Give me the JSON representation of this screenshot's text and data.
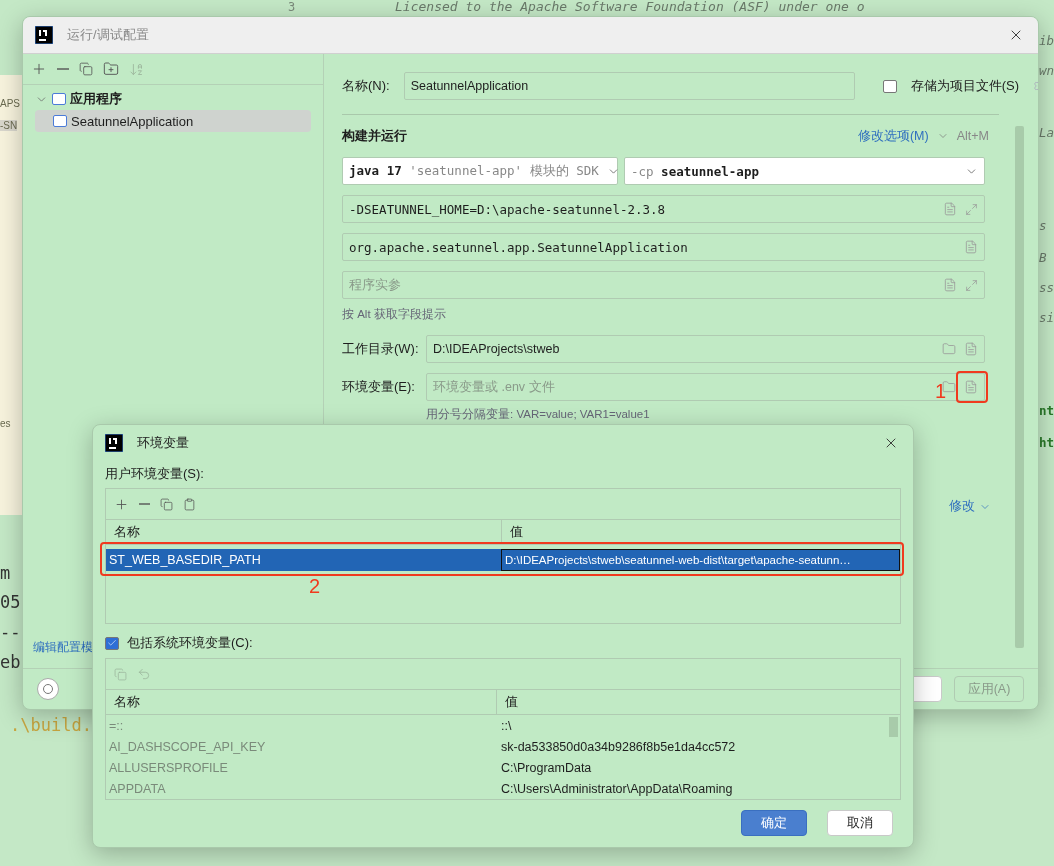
{
  "editor": {
    "line_number": "3",
    "comment": "Licensed to the Apache Software Foundation (ASF) under one o",
    "left_fragments": [
      {
        "text": "APS",
        "selected": false
      },
      {
        "text": "-SN",
        "selected": true
      },
      {
        "text": "es",
        "selected": false
      }
    ],
    "console_fragments": [
      "m",
      "05",
      "--",
      "eb"
    ],
    "command": ".\\build.",
    "right_fragments": [
      {
        "text": "ib",
        "kind": "comment"
      },
      {
        "text": "wn",
        "kind": "comment"
      },
      {
        "text": "La",
        "kind": "comment"
      },
      {
        "text": "s",
        "kind": "comment"
      },
      {
        "text": "B",
        "kind": "comment"
      },
      {
        "text": "ss",
        "kind": "comment"
      },
      {
        "text": "si",
        "kind": "comment"
      },
      {
        "text": "nt",
        "kind": "keyword"
      },
      {
        "text": "ht",
        "kind": "keyword"
      }
    ]
  },
  "config_dialog": {
    "title": "运行/调试配置",
    "tree": [
      {
        "label": "应用程序",
        "expanded": true,
        "children": [
          {
            "label": "SeatunnelApplication",
            "selected": true
          }
        ]
      }
    ],
    "edit_templates_link": "编辑配置模",
    "name_label": "名称(N):",
    "name_value": "SeatunnelApplication",
    "store_as_file": {
      "label": "存储为项目文件(S)",
      "checked": false
    },
    "section_title": "构建并运行",
    "modify_options": "修改选项(M)",
    "modify_shortcut": "Alt+M",
    "sdk": {
      "version": "java 17",
      "detail": "'seatunnel-app' 模块的 SDK"
    },
    "classpath": {
      "flag": "-cp",
      "module": "seatunnel-app"
    },
    "vm_options": "-DSEATUNNEL_HOME=D:\\apache-seatunnel-2.3.8",
    "main_class": "org.apache.seatunnel.app.SeatunnelApplication",
    "program_args": {
      "placeholder": "程序实参"
    },
    "alt_hint": "按 Alt 获取字段提示",
    "working_dir": {
      "label": "工作目录(W):",
      "value": "D:\\IDEAProjects\\stweb"
    },
    "env_vars": {
      "label": "环境变量(E):",
      "placeholder": "环境变量或  .env 文件",
      "hint": "用分号分隔变量: VAR=value; VAR1=value1",
      "annotation": "1"
    },
    "modify_link": "修改",
    "apply_button": {
      "label": "应用(A)",
      "disabled": true
    }
  },
  "env_dialog": {
    "title": "环境变量",
    "user_label": "用户环境变量(S):",
    "columns": [
      "名称",
      "值"
    ],
    "user_rows": [
      {
        "name": "ST_WEB_BASEDIR_PATH",
        "value": "D:\\IDEAProjects\\stweb\\seatunnel-web-dist\\target\\apache-seatunn…",
        "selected": true
      }
    ],
    "annotation": "2",
    "include_system": {
      "label": "包括系统环境变量(C):",
      "checked": true
    },
    "system_columns": [
      "名称",
      "值"
    ],
    "system_rows": [
      {
        "name": "=::",
        "value": "::\\"
      },
      {
        "name": "AI_DASHSCOPE_API_KEY",
        "value": "sk-da533850d0a34b9286f8b5e1da4cc572"
      },
      {
        "name": "ALLUSERSPROFILE",
        "value": "C:\\ProgramData"
      },
      {
        "name": "APPDATA",
        "value": "C:\\Users\\Administrator\\AppData\\Roaming"
      }
    ],
    "buttons": [
      {
        "label": "确定",
        "kind": "primary"
      },
      {
        "label": "取消",
        "kind": "secondary"
      }
    ]
  }
}
